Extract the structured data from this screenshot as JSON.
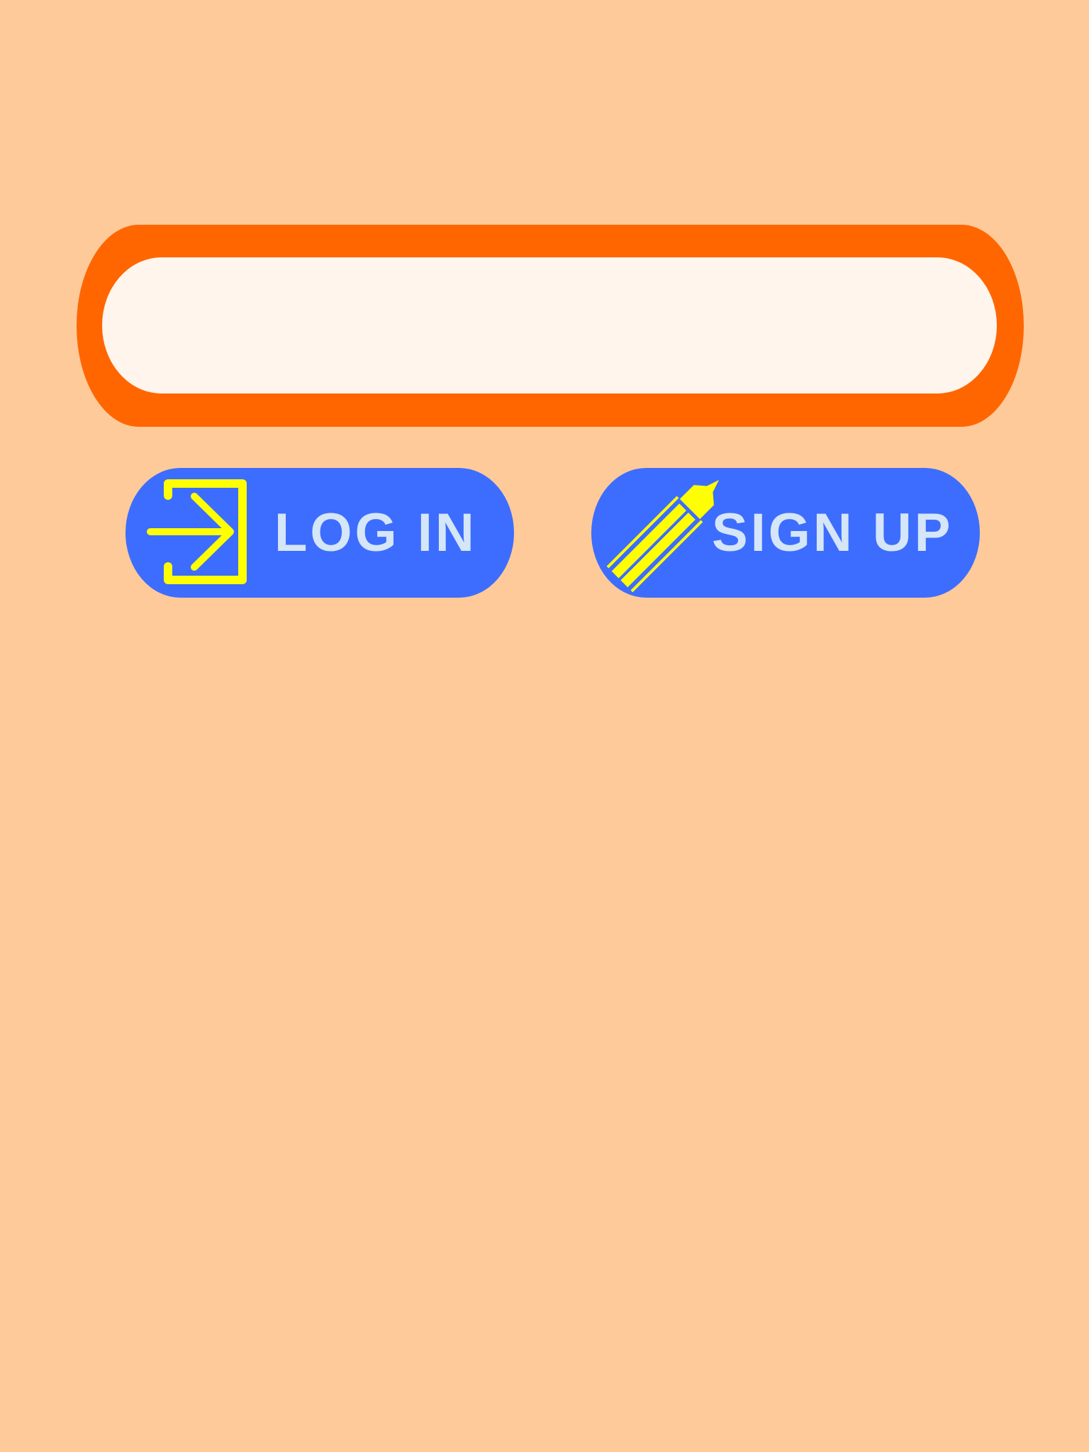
{
  "banner": {
    "value": ""
  },
  "buttons": {
    "login": {
      "label": "LOG IN",
      "icon": "login-arrow-icon"
    },
    "signup": {
      "label": "SIGN UP",
      "icon": "pencil-icon"
    }
  },
  "colors": {
    "background": "#ffca99",
    "banner_border": "#ff6600",
    "banner_fill": "#fff5ec",
    "button_fill": "#3d6dfe",
    "icon_color": "#ffff00",
    "label_color": "#d4e6f7"
  }
}
